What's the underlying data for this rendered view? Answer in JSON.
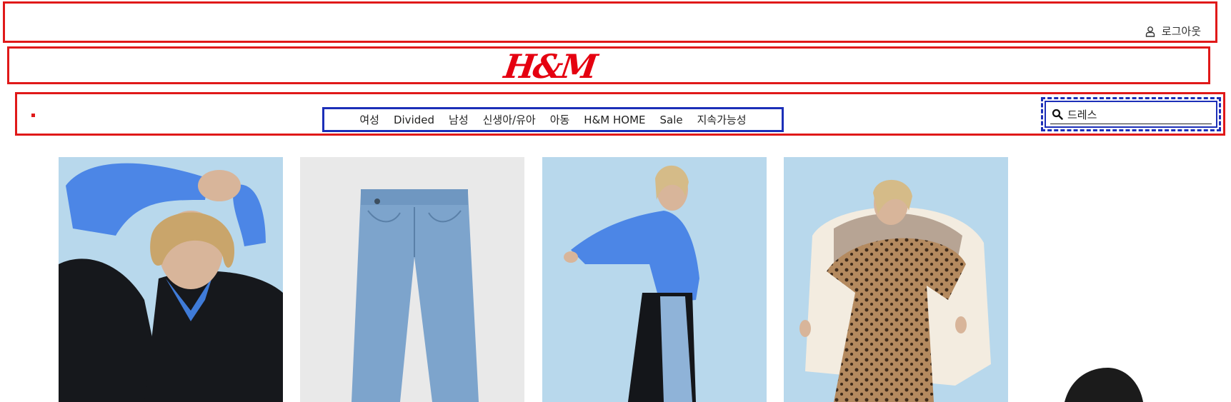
{
  "header": {
    "logout_label": "로그아웃",
    "logo_text": "H&M"
  },
  "nav": {
    "items": [
      "여성",
      "Divided",
      "남성",
      "신생아/유아",
      "아동",
      "H&M HOME",
      "Sale",
      "지속가능성"
    ]
  },
  "search": {
    "value": "드레스"
  },
  "products": [
    {
      "name": "model-blue-sweater-black-coat"
    },
    {
      "name": "blue-mom-jeans"
    },
    {
      "name": "model-blue-sweater-wide-jeans"
    },
    {
      "name": "model-leopard-dress-armchair"
    }
  ],
  "colors": {
    "brand_red": "#e50010",
    "annotation_red": "#e01919",
    "annotation_blue": "#1c2fb8",
    "sky_background": "#b8d8ec",
    "sweater_blue": "#4c86e6"
  }
}
